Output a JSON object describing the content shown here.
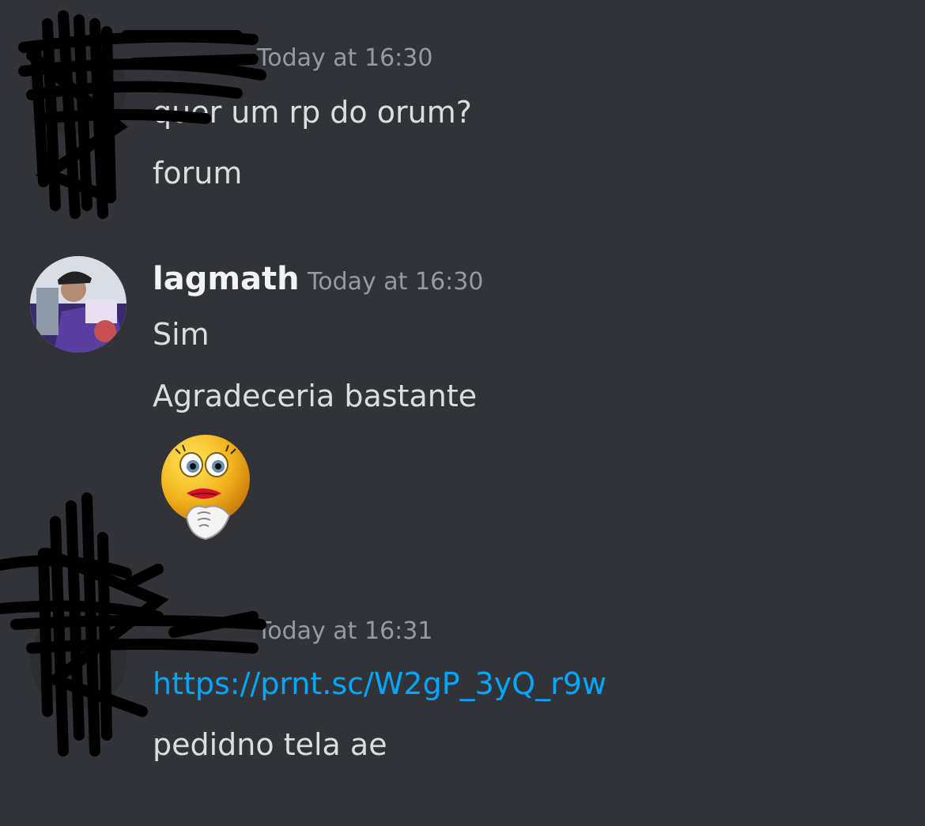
{
  "messages": [
    {
      "username": "",
      "timestamp": "Today at 16:30",
      "lines": [
        "quer um rp do orum?",
        "forum"
      ],
      "redacted": true
    },
    {
      "username": "lagmath",
      "timestamp": "Today at 16:30",
      "lines": [
        "Sim",
        "Agradeceria bastante"
      ],
      "sticker": "thinking-lady-emoji",
      "redacted": false
    },
    {
      "username": "",
      "timestamp": "Today at 16:31",
      "link": "https://prnt.sc/W2gP_3yQ_r9w",
      "lines": [
        "pedidno tela ae"
      ],
      "redacted": true
    }
  ],
  "colors": {
    "background": "#313338",
    "text": "#dbdee1",
    "timestamp": "#949ba4",
    "link": "#00a8fc",
    "username": "#f2f3f5",
    "redaction": "#000000"
  }
}
